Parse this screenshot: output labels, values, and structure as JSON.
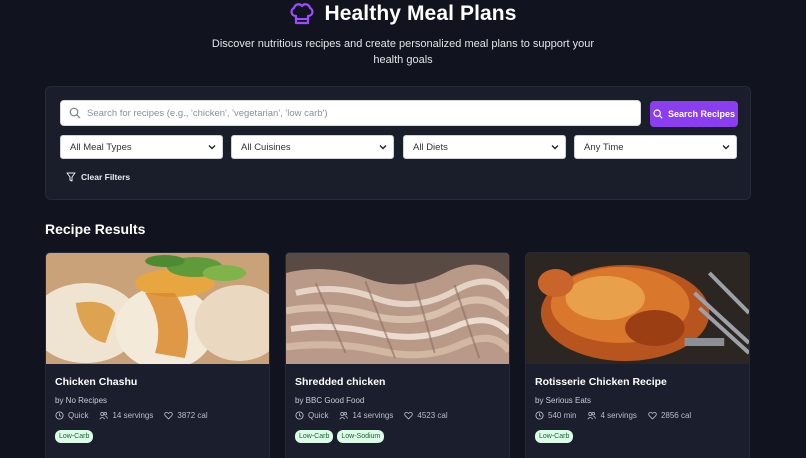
{
  "header": {
    "title": "Healthy Meal Plans",
    "subtitle": "Discover nutritious recipes and create personalized meal plans to support your health goals",
    "icon": "chef-hat-icon"
  },
  "search": {
    "placeholder": "Search for recipes (e.g., 'chicken', 'vegetarian', 'low carb')",
    "value": "",
    "button_label": "Search Recipes",
    "button_color": "#8b3df0"
  },
  "filters": {
    "meal_type": "All Meal Types",
    "cuisine": "All Cuisines",
    "diet": "All Diets",
    "time": "Any Time",
    "clear_label": "Clear Filters"
  },
  "results": {
    "title": "Recipe Results",
    "recipes": [
      {
        "title": "Chicken Chashu",
        "source": "by No Recipes",
        "time": "Quick",
        "servings": "14 servings",
        "calories": "3872 cal",
        "tags": [
          "Low-Carb"
        ]
      },
      {
        "title": "Shredded chicken",
        "source": "by BBC Good Food",
        "time": "Quick",
        "servings": "14 servings",
        "calories": "4523 cal",
        "tags": [
          "Low-Carb",
          "Low-Sodium"
        ]
      },
      {
        "title": "Rotisserie Chicken Recipe",
        "source": "by Serious Eats",
        "time": "540 min",
        "servings": "4 servings",
        "calories": "2856 cal",
        "tags": [
          "Low-Carb"
        ]
      }
    ]
  },
  "colors": {
    "background": "#11141f",
    "panel": "#1a1e2b",
    "accent": "#8b3df0",
    "tag_bg": "#dcfce7",
    "tag_text": "#166534"
  }
}
